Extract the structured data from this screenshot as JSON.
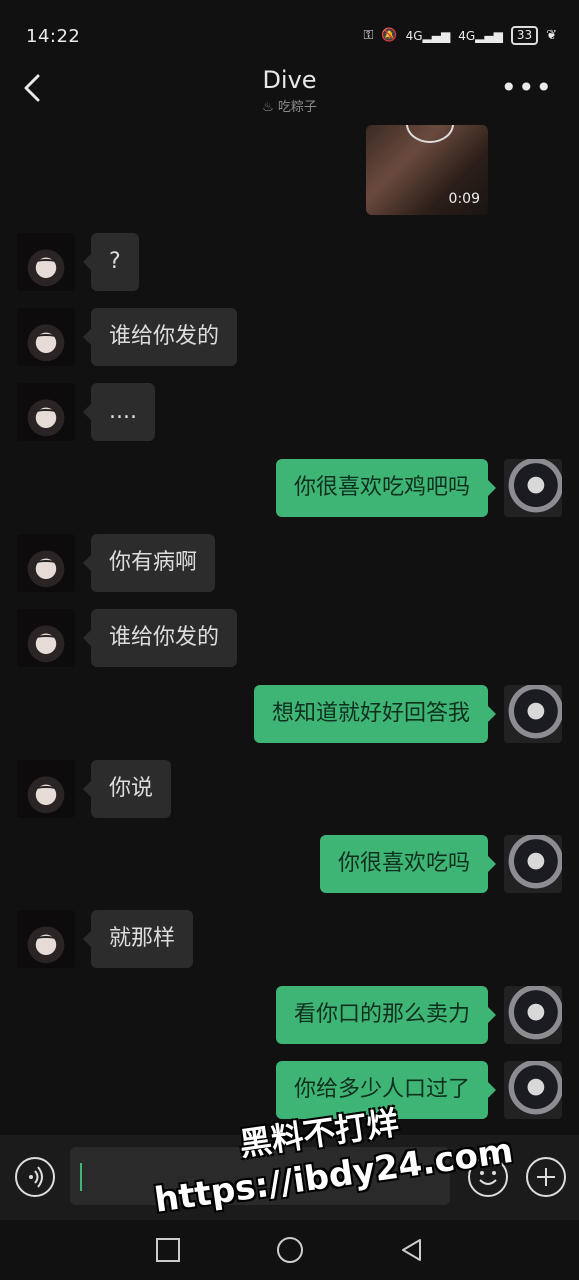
{
  "status": {
    "time": "14:22",
    "signal1": "4G",
    "signal2": "4G",
    "battery": "33"
  },
  "header": {
    "title": "Dive",
    "subtitle": "吃粽子"
  },
  "video": {
    "duration": "0:09"
  },
  "messages": [
    {
      "side": "left",
      "text": "?"
    },
    {
      "side": "left",
      "text": "谁给你发的"
    },
    {
      "side": "left",
      "text": "...."
    },
    {
      "side": "right",
      "text": "你很喜欢吃鸡吧吗"
    },
    {
      "side": "left",
      "text": "你有病啊"
    },
    {
      "side": "left",
      "text": "谁给你发的"
    },
    {
      "side": "right",
      "text": "想知道就好好回答我"
    },
    {
      "side": "left",
      "text": "你说"
    },
    {
      "side": "right",
      "text": "你很喜欢吃吗"
    },
    {
      "side": "left",
      "text": "就那样"
    },
    {
      "side": "right",
      "text": "看你口的那么卖力"
    },
    {
      "side": "right",
      "text": "你给多少人口过了"
    }
  ],
  "watermark": {
    "line1": "黑料不打烊",
    "line2": "https://ibdy24.com"
  }
}
